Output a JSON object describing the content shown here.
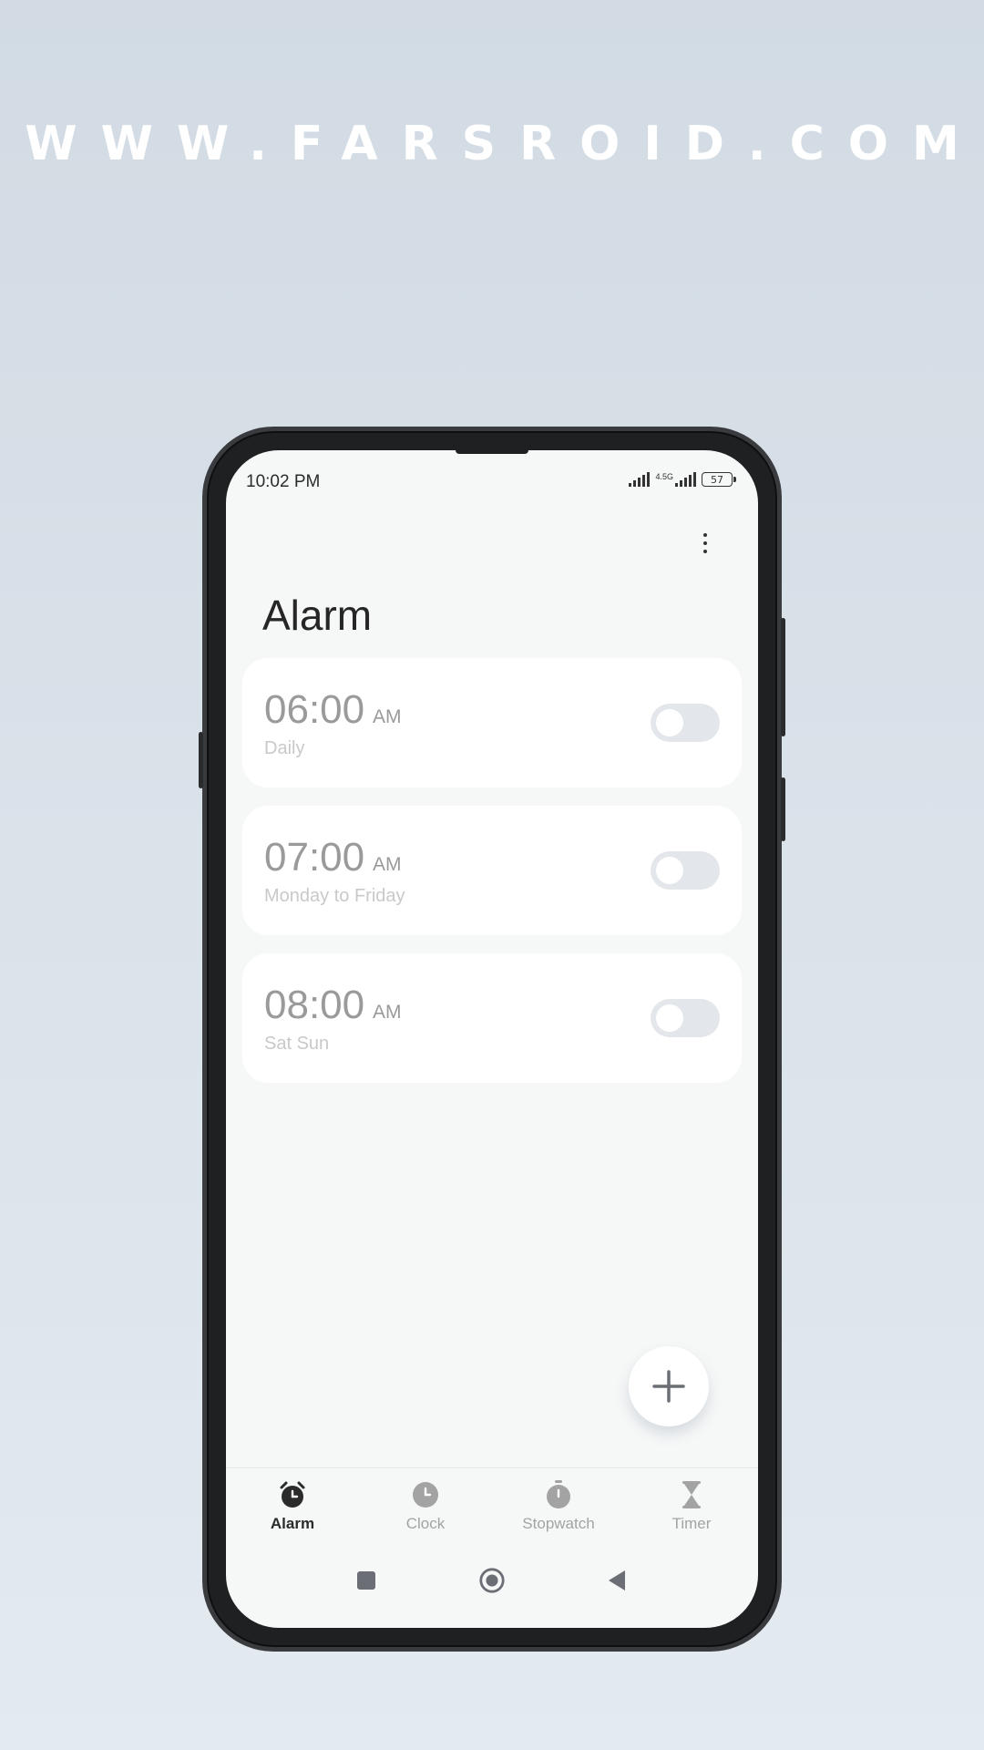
{
  "watermark": "WWW.FARSROID.COM",
  "status_bar": {
    "time": "10:02 PM",
    "network": "4.5G",
    "battery": "57"
  },
  "header": {
    "title": "Alarm",
    "menu_icon": "more-vertical-icon"
  },
  "alarms": [
    {
      "time": "06:00",
      "period": "AM",
      "repeat": "Daily",
      "enabled": false
    },
    {
      "time": "07:00",
      "period": "AM",
      "repeat": "Monday to Friday",
      "enabled": false
    },
    {
      "time": "08:00",
      "period": "AM",
      "repeat": "Sat Sun",
      "enabled": false
    }
  ],
  "fab": {
    "icon": "plus-icon"
  },
  "bottom_nav": {
    "items": [
      {
        "label": "Alarm",
        "icon": "alarm-clock-icon",
        "active": true
      },
      {
        "label": "Clock",
        "icon": "clock-icon",
        "active": false
      },
      {
        "label": "Stopwatch",
        "icon": "stopwatch-icon",
        "active": false
      },
      {
        "label": "Timer",
        "icon": "hourglass-icon",
        "active": false
      }
    ]
  },
  "system_nav": {
    "recents_icon": "square-icon",
    "home_icon": "circle-icon",
    "back_icon": "triangle-back-icon"
  },
  "colors": {
    "accent_active": "#2b2b2b",
    "inactive": "#a3a3a3",
    "toggle_off": "#e3e6ea",
    "screen_bg": "#f6f7f7",
    "card_bg": "#ffffff"
  }
}
